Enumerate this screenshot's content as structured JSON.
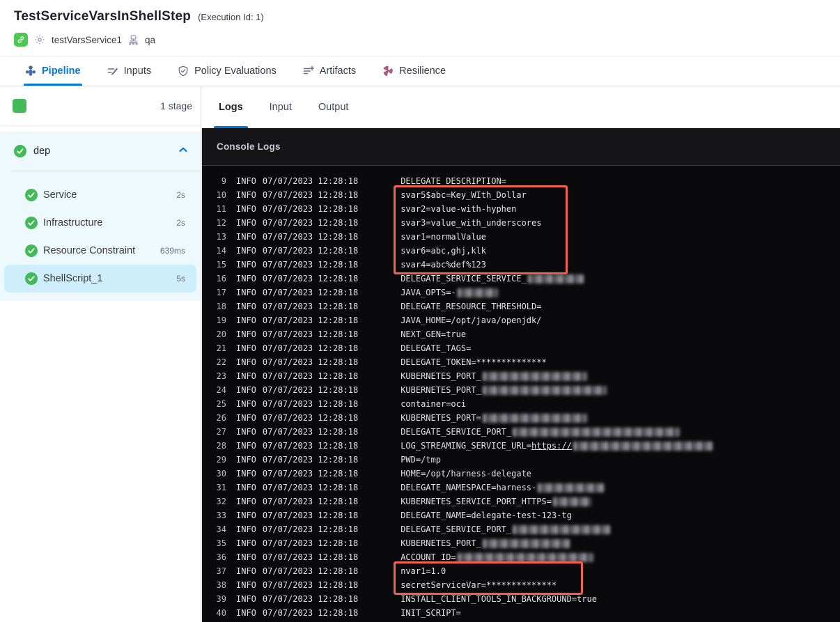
{
  "header": {
    "title": "TestServiceVarsInShellStep",
    "execution_id": "(Execution Id: 1)",
    "service_name": "testVarsService1",
    "environment_name": "qa"
  },
  "tabs": [
    {
      "label": "Pipeline",
      "active": true
    },
    {
      "label": "Inputs",
      "active": false
    },
    {
      "label": "Policy Evaluations",
      "active": false
    },
    {
      "label": "Artifacts",
      "active": false
    },
    {
      "label": "Resilience",
      "active": false
    }
  ],
  "sidebar": {
    "stage_count": "1 stage",
    "stage_group": {
      "name": "dep",
      "status": "success",
      "steps": [
        {
          "label": "Service",
          "duration": "2s",
          "selected": false
        },
        {
          "label": "Infrastructure",
          "duration": "2s",
          "selected": false
        },
        {
          "label": "Resource Constraint",
          "duration": "639ms",
          "selected": false
        },
        {
          "label": "ShellScript_1",
          "duration": "5s",
          "selected": true
        }
      ]
    }
  },
  "log_panel": {
    "tabs": [
      {
        "label": "Logs",
        "active": true
      },
      {
        "label": "Input",
        "active": false
      },
      {
        "label": "Output",
        "active": false
      }
    ],
    "console_title": "Console Logs",
    "level": "INFO",
    "timestamp": "07/07/2023 12:28:18",
    "highlight_color": "#f4604f",
    "lines": [
      {
        "num": 9,
        "segments": [
          {
            "t": "DELEGATE_DESCRIPTION="
          }
        ]
      },
      {
        "num": 10,
        "hl": 1,
        "segments": [
          {
            "t": "svar5$abc=Key_WIth_Dollar"
          }
        ]
      },
      {
        "num": 11,
        "hl": 1,
        "segments": [
          {
            "t": "svar2=value-with-hyphen"
          }
        ]
      },
      {
        "num": 12,
        "hl": 1,
        "segments": [
          {
            "t": "svar3=value_with_underscores"
          }
        ]
      },
      {
        "num": 13,
        "hl": 1,
        "segments": [
          {
            "t": "svar1=normalValue"
          }
        ]
      },
      {
        "num": 14,
        "hl": 1,
        "segments": [
          {
            "t": "svar6=abc,ghj,klk"
          }
        ]
      },
      {
        "num": 15,
        "hl": 1,
        "segments": [
          {
            "t": "svar4=abc%def%123"
          }
        ]
      },
      {
        "num": 16,
        "segments": [
          {
            "t": "DELEGATE_SERVICE_SERVICE_"
          },
          {
            "r": 80
          }
        ]
      },
      {
        "num": 17,
        "segments": [
          {
            "t": "JAVA_OPTS=-"
          },
          {
            "r": 58
          }
        ]
      },
      {
        "num": 18,
        "segments": [
          {
            "t": "DELEGATE_RESOURCE_THRESHOLD="
          }
        ]
      },
      {
        "num": 19,
        "segments": [
          {
            "t": "JAVA_HOME=/opt/java/openjdk/"
          }
        ]
      },
      {
        "num": 20,
        "segments": [
          {
            "t": "NEXT_GEN=true"
          }
        ]
      },
      {
        "num": 21,
        "segments": [
          {
            "t": "DELEGATE_TAGS="
          }
        ]
      },
      {
        "num": 22,
        "segments": [
          {
            "t": "DELEGATE_TOKEN=**************"
          }
        ]
      },
      {
        "num": 23,
        "segments": [
          {
            "t": "KUBERNETES_PORT_"
          },
          {
            "r": 150
          }
        ]
      },
      {
        "num": 24,
        "segments": [
          {
            "t": "KUBERNETES_PORT_"
          },
          {
            "r": 178
          }
        ]
      },
      {
        "num": 25,
        "segments": [
          {
            "t": "container=oci"
          }
        ]
      },
      {
        "num": 26,
        "segments": [
          {
            "t": "KUBERNETES_PORT="
          },
          {
            "r": 150
          }
        ]
      },
      {
        "num": 27,
        "segments": [
          {
            "t": "DELEGATE_SERVICE_PORT_"
          },
          {
            "r": 240
          }
        ]
      },
      {
        "num": 28,
        "segments": [
          {
            "t": "LOG_STREAMING_SERVICE_URL="
          },
          {
            "t": "https://",
            "link": true
          },
          {
            "r": 200
          }
        ]
      },
      {
        "num": 29,
        "segments": [
          {
            "t": "PWD=/tmp"
          }
        ]
      },
      {
        "num": 30,
        "segments": [
          {
            "t": "HOME=/opt/harness-delegate"
          }
        ]
      },
      {
        "num": 31,
        "segments": [
          {
            "t": "DELEGATE_NAMESPACE=harness-"
          },
          {
            "r": 95
          }
        ]
      },
      {
        "num": 32,
        "segments": [
          {
            "t": "KUBERNETES_SERVICE_PORT_HTTPS="
          },
          {
            "r": 55
          }
        ]
      },
      {
        "num": 33,
        "segments": [
          {
            "t": "DELEGATE_NAME=delegate-test-123-tg"
          }
        ]
      },
      {
        "num": 34,
        "segments": [
          {
            "t": "DELEGATE_SERVICE_PORT_"
          },
          {
            "r": 140
          }
        ]
      },
      {
        "num": 35,
        "segments": [
          {
            "t": "KUBERNETES_PORT_"
          },
          {
            "r": 125
          }
        ]
      },
      {
        "num": 36,
        "segments": [
          {
            "t": "ACCOUNT_ID="
          },
          {
            "r": 195
          }
        ]
      },
      {
        "num": 37,
        "hl": 2,
        "segments": [
          {
            "t": "nvar1=1.0"
          }
        ]
      },
      {
        "num": 38,
        "hl": 2,
        "segments": [
          {
            "t": "secretServiceVar=**************"
          }
        ]
      },
      {
        "num": 39,
        "segments": [
          {
            "t": "INSTALL_CLIENT_TOOLS_IN_BACKGROUND=true"
          }
        ]
      },
      {
        "num": 40,
        "segments": [
          {
            "t": "INIT_SCRIPT="
          }
        ]
      }
    ]
  },
  "colors": {
    "accent_blue": "#0278d5",
    "success_green": "#42ba57",
    "module_green": "#4dc952",
    "resilience_pink": "#e5437e",
    "highlight_red": "#f4604f"
  }
}
